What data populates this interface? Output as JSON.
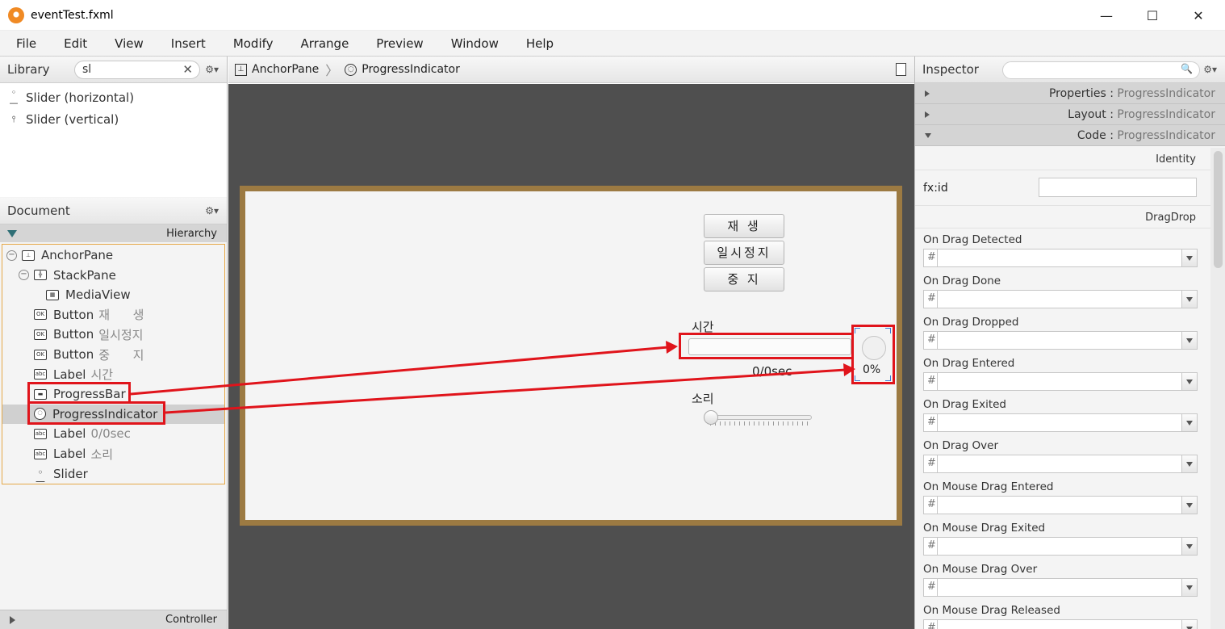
{
  "window": {
    "title": "eventTest.fxml",
    "minimize": "—",
    "maximize": "☐",
    "close": "✕"
  },
  "menu": [
    "File",
    "Edit",
    "View",
    "Insert",
    "Modify",
    "Arrange",
    "Preview",
    "Window",
    "Help"
  ],
  "library": {
    "title": "Library",
    "search_value": "sl",
    "clear_glyph": "✕",
    "gear_glyph": "⚙▾",
    "items": [
      {
        "label": "Slider  (horizontal)",
        "icon": "slider-horizontal-icon",
        "glyph": "◦—"
      },
      {
        "label": "Slider  (vertical)",
        "icon": "slider-vertical-icon",
        "glyph": "⫯"
      }
    ]
  },
  "document": {
    "title": "Document",
    "gear_glyph": "⚙▾",
    "hierarchy_label": "Hierarchy",
    "controller_label": "Controller",
    "nodes": [
      {
        "type": "AnchorPane",
        "text": "",
        "indent": 0,
        "toggle": "−",
        "glyph": "⊥",
        "icon": "anchorpane-icon"
      },
      {
        "type": "StackPane",
        "text": "",
        "indent": 1,
        "toggle": "−",
        "glyph": "╬",
        "icon": "stackpane-icon"
      },
      {
        "type": "MediaView",
        "text": "",
        "indent": 2,
        "toggle": "",
        "glyph": "▦",
        "icon": "mediaview-icon"
      },
      {
        "type": "Button",
        "text": "재      생",
        "indent": 1,
        "toggle": "",
        "glyph": "OK",
        "icon": "button-icon"
      },
      {
        "type": "Button",
        "text": "일시정지",
        "indent": 1,
        "toggle": "",
        "glyph": "OK",
        "icon": "button-icon"
      },
      {
        "type": "Button",
        "text": "중      지",
        "indent": 1,
        "toggle": "",
        "glyph": "OK",
        "icon": "button-icon"
      },
      {
        "type": "Label",
        "text": "시간",
        "indent": 1,
        "toggle": "",
        "glyph": "abc",
        "icon": "label-icon"
      },
      {
        "type": "ProgressBar",
        "text": "",
        "indent": 1,
        "toggle": "",
        "glyph": "▬",
        "icon": "progressbar-icon"
      },
      {
        "type": "ProgressIndicator",
        "text": "",
        "indent": 1,
        "toggle": "",
        "glyph": "◌",
        "icon": "progressindicator-icon",
        "selected": true
      },
      {
        "type": "Label",
        "text": "0/0sec",
        "indent": 1,
        "toggle": "",
        "glyph": "abc",
        "icon": "label-icon"
      },
      {
        "type": "Label",
        "text": "소리",
        "indent": 1,
        "toggle": "",
        "glyph": "abc",
        "icon": "label-icon"
      },
      {
        "type": "Slider",
        "text": "",
        "indent": 1,
        "toggle": "",
        "glyph": "◦—",
        "icon": "slider-icon"
      }
    ]
  },
  "breadcrumb": {
    "items": [
      "AnchorPane",
      "ProgressIndicator"
    ],
    "separator": "〉",
    "glyphs": [
      "⊥",
      "◌"
    ]
  },
  "canvas": {
    "buttons": [
      "재   생",
      "일시정지",
      "중   지"
    ],
    "time_label": "시간",
    "time_readout": "0/0sec",
    "progress_percent": "0%",
    "sound_label": "소리",
    "progress_bar_value": 0,
    "slider_value": 0
  },
  "inspector": {
    "title": "Inspector",
    "search_glyph": "🔍",
    "gear_glyph": "⚙▾",
    "sections": [
      {
        "name": "Properties",
        "target": "ProgressIndicator",
        "expanded": false
      },
      {
        "name": "Layout",
        "target": "ProgressIndicator",
        "expanded": false
      },
      {
        "name": "Code",
        "target": "ProgressIndicator",
        "expanded": true
      }
    ],
    "identity_title": "Identity",
    "fxid_label": "fx:id",
    "fxid_value": "",
    "dragdrop_title": "DragDrop",
    "hash": "#",
    "events": [
      "On Drag Detected",
      "On Drag Done",
      "On Drag Dropped",
      "On Drag Entered",
      "On Drag Exited",
      "On Drag Over",
      "On Mouse Drag Entered",
      "On Mouse Drag Exited",
      "On Mouse Drag Over",
      "On Mouse Drag Released"
    ]
  },
  "colors": {
    "anchor_border": "#9c7a42",
    "canvas_bg": "#4f4f4f",
    "annotation": "#e0141b",
    "selection_outline": "#e5a847"
  }
}
